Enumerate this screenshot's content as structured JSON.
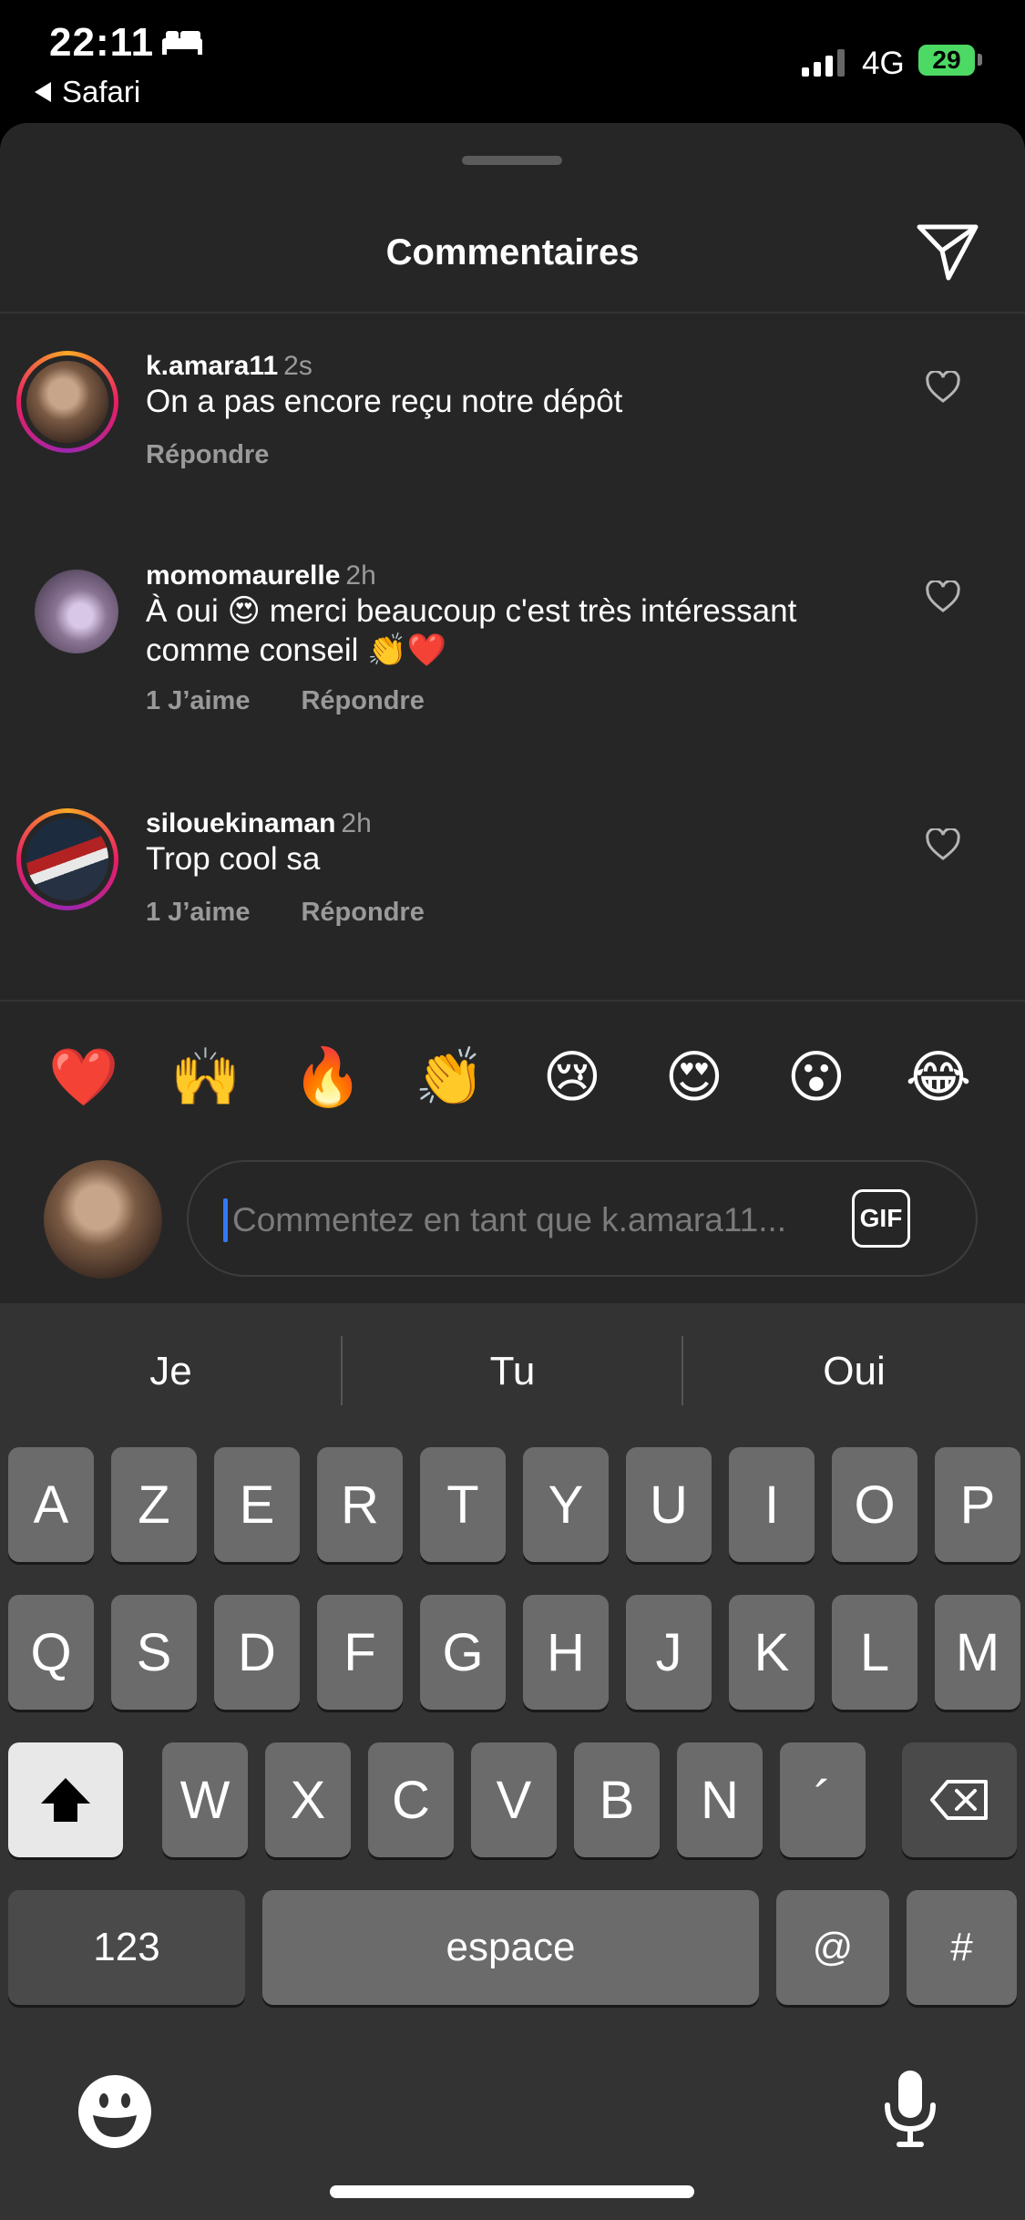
{
  "status_bar": {
    "time": "22:11",
    "back_app": "Safari",
    "network": "4G",
    "battery": "29"
  },
  "sheet": {
    "title": "Commentaires"
  },
  "comments": [
    {
      "user": "k.amara11",
      "time": "2s",
      "text": "On a pas encore reçu notre dépôt",
      "likes": "",
      "reply": "Répondre"
    },
    {
      "user": "momomaurelle",
      "time": "2h",
      "text": "À oui 😍 merci beaucoup c'est très intéressant comme conseil 👏❤️",
      "likes": "1 J’aime",
      "reply": "Répondre"
    },
    {
      "user": "silouekinaman",
      "time": "2h",
      "text": "Trop cool sa",
      "likes": "1 J’aime",
      "reply": "Répondre"
    }
  ],
  "emoji_reactions": [
    "❤️",
    "🙌",
    "🔥",
    "👏",
    "😢",
    "😍",
    "😮",
    "😂"
  ],
  "comment_input": {
    "placeholder": "Commentez en tant que k.amara11...",
    "value": "",
    "gif_label": "GIF"
  },
  "keyboard": {
    "suggestions": [
      "Je",
      "Tu",
      "Oui"
    ],
    "row1": [
      "A",
      "Z",
      "E",
      "R",
      "T",
      "Y",
      "U",
      "I",
      "O",
      "P"
    ],
    "row2": [
      "Q",
      "S",
      "D",
      "F",
      "G",
      "H",
      "J",
      "K",
      "L",
      "M"
    ],
    "row3": [
      "W",
      "X",
      "C",
      "V",
      "B",
      "N",
      "´"
    ],
    "numbers_label": "123",
    "space_label": "espace",
    "at_label": "@",
    "hash_label": "#"
  }
}
